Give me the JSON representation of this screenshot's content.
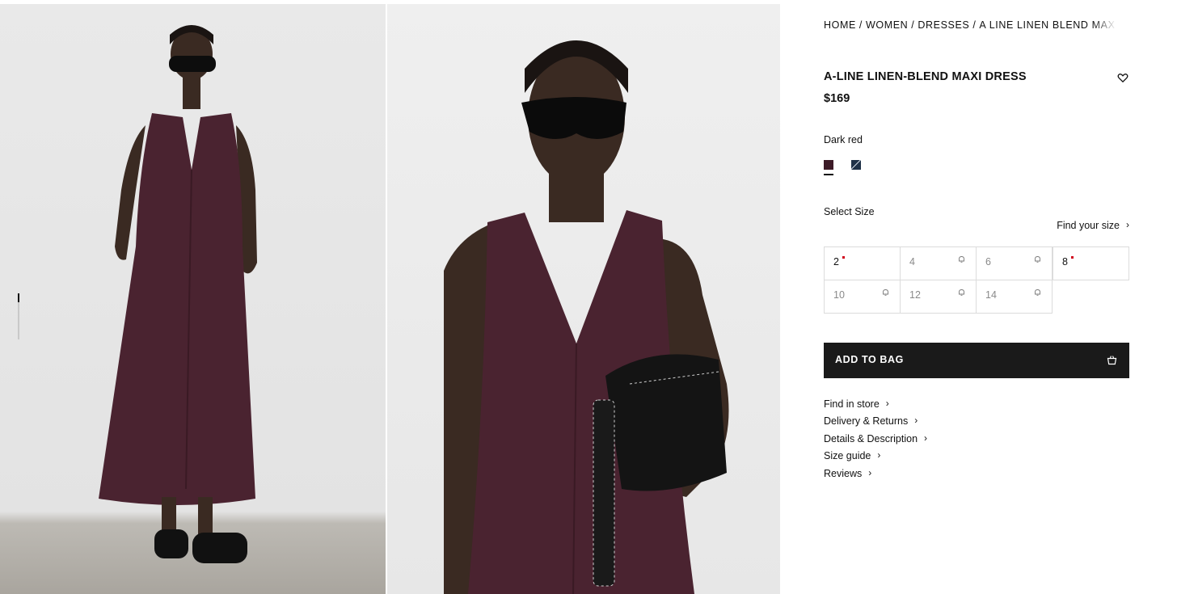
{
  "gallery": {
    "images": [
      {
        "name": "full-length-front-view"
      },
      {
        "name": "close-up-with-bag"
      }
    ],
    "progress": 0.2
  },
  "breadcrumb": [
    {
      "label": "HOME"
    },
    {
      "label": "WOMEN"
    },
    {
      "label": "DRESSES"
    },
    {
      "label": "A LINE LINEN BLEND MAXI DRESS"
    }
  ],
  "product": {
    "title": "A-LINE LINEN-BLEND MAXI DRESS",
    "price": "$169",
    "wishlist_icon": "heart-icon"
  },
  "color": {
    "selected_name": "Dark red",
    "swatches": [
      {
        "color": "#3d1b27",
        "selected": true
      },
      {
        "color": "#1f3147",
        "selected": false
      }
    ]
  },
  "sizes": {
    "label": "Select Size",
    "find_label": "Find your size",
    "options": [
      {
        "label": "2",
        "state": "low-stock"
      },
      {
        "label": "4",
        "state": "notify"
      },
      {
        "label": "6",
        "state": "notify"
      },
      {
        "label": "8",
        "state": "low-stock"
      },
      {
        "label": "10",
        "state": "notify"
      },
      {
        "label": "12",
        "state": "notify"
      },
      {
        "label": "14",
        "state": "notify"
      }
    ]
  },
  "cta": {
    "add_to_bag": "ADD TO BAG",
    "icon": "shopping-bag-icon"
  },
  "links": [
    {
      "label": "Find in store"
    },
    {
      "label": "Delivery & Returns"
    },
    {
      "label": "Details & Description"
    },
    {
      "label": "Size guide"
    },
    {
      "label": "Reviews"
    }
  ]
}
